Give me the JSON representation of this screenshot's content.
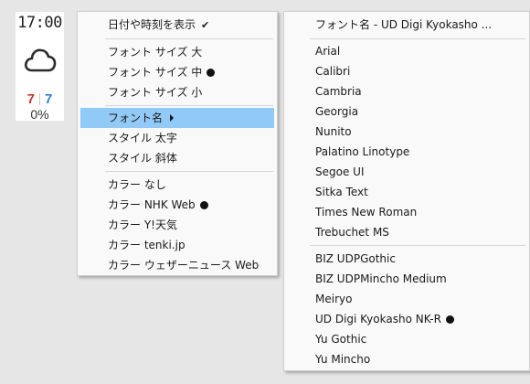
{
  "widget": {
    "time": "17:00",
    "weather_icon": "cloud-icon",
    "temp_max": "7",
    "temp_min": "7",
    "rain_chance": "0%",
    "colors": {
      "max": "#d0302a",
      "min": "#2f7fd0"
    }
  },
  "menu_left": {
    "items": [
      {
        "label": "日付や時刻を表示",
        "mark": "✔"
      },
      {
        "label": "フォント サイズ 大"
      },
      {
        "label": "フォント サイズ 中",
        "selected": true
      },
      {
        "label": "フォント サイズ 小"
      },
      {
        "label": "フォント名",
        "submenu": true,
        "active": true
      },
      {
        "label": "スタイル 太字"
      },
      {
        "label": "スタイル 斜体"
      },
      {
        "label": "カラー なし"
      },
      {
        "label": "カラー NHK Web",
        "selected": true
      },
      {
        "label": "カラー Y!天気"
      },
      {
        "label": "カラー tenki.jp"
      },
      {
        "label": "カラー ウェザーニュース Web"
      }
    ]
  },
  "menu_right": {
    "header": "フォント名 - UD Digi Kyokasho ...",
    "fonts_group1": [
      "Arial",
      "Calibri",
      "Cambria",
      "Georgia",
      "Nunito",
      "Palatino Linotype",
      "Segoe UI",
      "Sitka Text",
      "Times New Roman",
      "Trebuchet MS"
    ],
    "fonts_group2": [
      "BIZ UDPGothic",
      "BIZ UDPMincho Medium",
      "Meiryo",
      "UD Digi Kyokasho NK-R",
      "Yu Gothic",
      "Yu Mincho"
    ],
    "selected_font": "UD Digi Kyokasho NK-R"
  },
  "accent_color": "#91c9f7"
}
